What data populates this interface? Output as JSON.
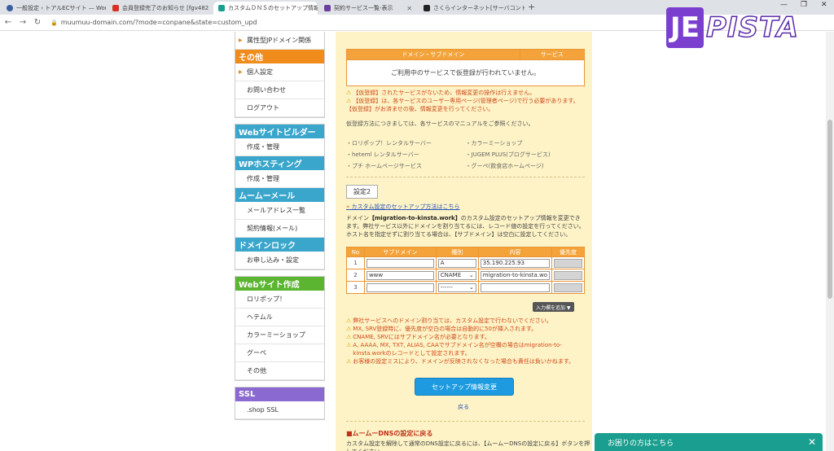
{
  "browser": {
    "tabs": [
      {
        "label": "一般設定 ‹ トアルECサイト — Wor",
        "color": "#3a5fa0"
      },
      {
        "label": "会員登録完了のお知らせ [fgv482",
        "color": "#d93025"
      },
      {
        "label": "カスタムＤＮＳのセットアップ情報変",
        "color": "#1a9e8f"
      },
      {
        "label": "契約サービス一覧-表示",
        "color": "#6b3fa0"
      },
      {
        "label": "さくらインターネット[サーバコントロールパ",
        "color": "#222222"
      }
    ],
    "url": "muumuu-domain.com/?mode=conpane&state=custom_upd"
  },
  "logo": {
    "badge": "JE",
    "text": "PISTA"
  },
  "sidebar": {
    "top_items": [
      "属性型JPドメイン関係"
    ],
    "groups": [
      {
        "title": "その他",
        "color": "orange",
        "items": [
          "個人設定",
          "お問い合わせ",
          "ログアウト"
        ]
      },
      {
        "title": "Webサイトビルダー",
        "color": "blue",
        "items": [
          "作成・管理"
        ]
      },
      {
        "title": "WPホスティング",
        "color": "blue",
        "items": [
          "作成・管理"
        ]
      },
      {
        "title": "ムームーメール",
        "color": "blue",
        "items": [
          "メールアドレス一覧",
          "契約情報(メール)"
        ]
      },
      {
        "title": "ドメインロック",
        "color": "blue",
        "items": [
          "お申し込み・設定"
        ]
      },
      {
        "title": "Webサイト作成",
        "color": "green",
        "items": [
          "ロリポップ！",
          "ヘテムル",
          "カラーミーショップ",
          "グーペ",
          "その他"
        ]
      },
      {
        "title": "SSL",
        "color": "purple",
        "items": [
          ".shop SSL"
        ]
      }
    ]
  },
  "services_table": {
    "headers": [
      "ドメイン・サブドメイン",
      "サービス"
    ],
    "empty_message": "ご利用中のサービスで仮登録が行われていません。"
  },
  "notes": {
    "warnings": [
      "【仮登録】されたサービスがないため、情報変更の操作は行えません。",
      "【仮登録】は、各サービスのユーザー専用ページ(管理者ページ)で行う必要があります。",
      "【仮登録】がお済ませの後、情報変更を行ってください。"
    ],
    "manual": "仮登録方法につきましては、各サービスのマニュアルをご参照ください。",
    "links": [
      "・ロリポップ！レンタルサーバー",
      "・カラーミーショップ",
      "・heteml レンタルサーバー",
      "・JUGEM PLUS(ブログサービス)",
      "・プチ ホームページサービス",
      "・グーペ(飲食店ホームページ)"
    ]
  },
  "settings2": {
    "badge": "設定2",
    "link": "カスタム設定のセットアップ方法はこちら",
    "desc_prefix": "ドメイン",
    "domain": "【migration-to-kinsta.work】",
    "desc_suffix": "のカスタム設定のセットアップ情報を変更できます。弊社サービス以外にドメインを割り当てるには、レコード値の設定を行ってください。ホスト名を指定せずに割り当てる場合は、【サブドメイン】は空白に設定してください。"
  },
  "dns_table": {
    "headers": [
      "No",
      "サブドメイン",
      "種別",
      "内容",
      "優先度"
    ],
    "rows": [
      {
        "no": "1",
        "sub": "",
        "type": "A",
        "has_arrow": false,
        "content": "35.190.225.93"
      },
      {
        "no": "2",
        "sub": "www",
        "type": "CNAME",
        "has_arrow": true,
        "content": "migration-to-kinsta.wo"
      },
      {
        "no": "3",
        "sub": "",
        "type": "------",
        "has_arrow": true,
        "content": ""
      }
    ],
    "add_row_label": "入力欄を追加 ▼"
  },
  "notes2": [
    "弊社サービスへのドメイン割り当ては、カスタム設定で行わないでください。",
    "MX, SRV登録時に、優先度が空白の場合は自動的に50が挿入されます。",
    "CNAME, SRVにはサブドメイン名が必要となります。",
    "A, AAAA, MX, TXT, ALIAS, CAAでサブドメイン名が空欄の場合はmigration-to-kinsta.workのレコードとして設定されます。",
    "お客様の設定ミスにより、ドメインが反映されなくなった場合も責任は負いかねます。"
  ],
  "submit_label": "セットアップ情報変更",
  "back_label": "戻る",
  "bottom": {
    "title": "■ムームーDNSの設定に戻る",
    "desc": "カスタム設定を解除して通常のDNS設定に戻るには、【ムームーDNSの設定に戻る】ボタンを押してください。"
  },
  "help_label": "お困りの方はこちら"
}
